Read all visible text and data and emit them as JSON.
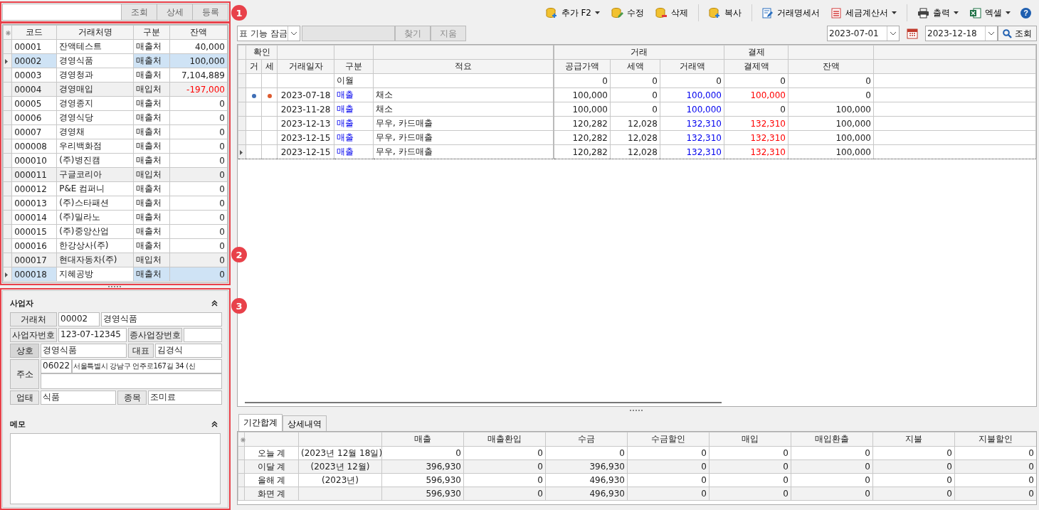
{
  "left_panel": {
    "search": {
      "buttons": [
        "조회",
        "상세",
        "등록"
      ]
    },
    "grid": {
      "columns": [
        "코드",
        "거래처명",
        "구분",
        "잔액"
      ],
      "rows": [
        {
          "code": "00001",
          "name": "잔액테스트",
          "type": "매출처",
          "balance": "40,000",
          "kind": "sale",
          "negative": false,
          "selected": false
        },
        {
          "code": "00002",
          "name": "경영식품",
          "type": "매출처",
          "balance": "100,000",
          "kind": "sale",
          "negative": false,
          "selected": true
        },
        {
          "code": "00003",
          "name": "경영청과",
          "type": "매출처",
          "balance": "7,104,889",
          "kind": "sale",
          "negative": false,
          "selected": false
        },
        {
          "code": "00004",
          "name": "경영매입",
          "type": "매입처",
          "balance": "-197,000",
          "kind": "purchase",
          "negative": true,
          "selected": false
        },
        {
          "code": "00005",
          "name": "경영종지",
          "type": "매출처",
          "balance": "0",
          "kind": "sale",
          "negative": false,
          "selected": false
        },
        {
          "code": "00006",
          "name": "경영식당",
          "type": "매출처",
          "balance": "0",
          "kind": "sale",
          "negative": false,
          "selected": false
        },
        {
          "code": "00007",
          "name": "경영채",
          "type": "매출처",
          "balance": "0",
          "kind": "sale",
          "negative": false,
          "selected": false
        },
        {
          "code": "000008",
          "name": "우리백화점",
          "type": "매출처",
          "balance": "0",
          "kind": "sale",
          "negative": false,
          "selected": false
        },
        {
          "code": "000010",
          "name": "(주)병진캠",
          "type": "매출처",
          "balance": "0",
          "kind": "sale",
          "negative": false,
          "selected": false
        },
        {
          "code": "000011",
          "name": "구글코리아",
          "type": "매입처",
          "balance": "0",
          "kind": "purchase",
          "negative": false,
          "selected": false
        },
        {
          "code": "000012",
          "name": "P&E 컴퍼니",
          "type": "매출처",
          "balance": "0",
          "kind": "sale",
          "negative": false,
          "selected": false
        },
        {
          "code": "000013",
          "name": "(주)스타패션",
          "type": "매출처",
          "balance": "0",
          "kind": "sale",
          "negative": false,
          "selected": false
        },
        {
          "code": "000014",
          "name": "(주)밀라노",
          "type": "매출처",
          "balance": "0",
          "kind": "sale",
          "negative": false,
          "selected": false
        },
        {
          "code": "000015",
          "name": "(주)중앙산업",
          "type": "매출처",
          "balance": "0",
          "kind": "sale",
          "negative": false,
          "selected": false
        },
        {
          "code": "000016",
          "name": "한강상사(주)",
          "type": "매출처",
          "balance": "0",
          "kind": "sale",
          "negative": false,
          "selected": false
        },
        {
          "code": "000017",
          "name": "현대자동차(주)",
          "type": "매입처",
          "balance": "0",
          "kind": "purchase",
          "negative": false,
          "selected": false
        },
        {
          "code": "000018",
          "name": "지혜공방",
          "type": "매출처",
          "balance": "0",
          "kind": "sale",
          "negative": false,
          "selected": true
        }
      ]
    }
  },
  "detail": {
    "title": "사업자",
    "client_label": "거래처",
    "client_code": "00002",
    "client_name": "경영식품",
    "bizno_label": "사업자번호",
    "bizno": "123-07-12345",
    "subbiz_label": "종사업장번호",
    "company_label": "상호",
    "company": "경영식품",
    "ceo_label": "대표",
    "ceo": "김경식",
    "address_label": "주소",
    "zip": "06022",
    "address": "서울특별시 강남구 언주로167길 34 (신",
    "biztype_label": "업태",
    "biztype": "식품",
    "item_label": "종목",
    "item": "조미료",
    "memo_title": "메모"
  },
  "toolbar": [
    {
      "label": "추가 F2",
      "kind": "db-plus",
      "dropdown": true
    },
    {
      "label": "수정",
      "kind": "db-edit",
      "dropdown": false
    },
    {
      "label": "삭제",
      "kind": "db-minus",
      "dropdown": false
    },
    {
      "label": "복사",
      "kind": "db-copy",
      "dropdown": false
    },
    {
      "label": "거래명세서",
      "kind": "doc-edit",
      "dropdown": false
    },
    {
      "label": "세금계산서",
      "kind": "doc-table",
      "dropdown": true
    },
    {
      "label": "출력",
      "kind": "printer",
      "dropdown": true
    },
    {
      "label": "엑셀",
      "kind": "excel",
      "dropdown": true
    }
  ],
  "help": "?",
  "filter": {
    "lock_option": "표 기능 잠금",
    "find": "찾기",
    "clear": "지움",
    "date_from": "2023-07-01",
    "date_to": "2023-12-18",
    "search": "조회"
  },
  "ledger": {
    "groups": {
      "confirm": "확인",
      "trade": "거래",
      "payment": "결제"
    },
    "columns": [
      "거",
      "세",
      "거래일자",
      "구분",
      "적요",
      "공급가액",
      "세액",
      "거래액",
      "결제액",
      "잔액"
    ],
    "rows": [
      {
        "kind": "carryover",
        "date": "",
        "type": "이월",
        "memo": "",
        "supply": "0",
        "tax": "0",
        "amount": "0",
        "payment": "0",
        "balance": "0",
        "confirm_trade": false,
        "confirm_tax": false,
        "paid": false,
        "selected": false
      },
      {
        "kind": "entry",
        "date": "2023-07-18",
        "type": "매출",
        "memo": "채소",
        "supply": "100,000",
        "tax": "0",
        "amount": "100,000",
        "payment": "100,000",
        "balance": "0",
        "confirm_trade": true,
        "confirm_tax": true,
        "paid": true,
        "selected": false
      },
      {
        "kind": "entry",
        "date": "2023-11-28",
        "type": "매출",
        "memo": "채소",
        "supply": "100,000",
        "tax": "0",
        "amount": "100,000",
        "payment": "0",
        "balance": "100,000",
        "confirm_trade": false,
        "confirm_tax": false,
        "paid": false,
        "selected": false
      },
      {
        "kind": "entry",
        "date": "2023-12-13",
        "type": "매출",
        "memo": "무우, 카드매출",
        "supply": "120,282",
        "tax": "12,028",
        "amount": "132,310",
        "payment": "132,310",
        "balance": "100,000",
        "confirm_trade": false,
        "confirm_tax": false,
        "paid": true,
        "selected": false
      },
      {
        "kind": "entry",
        "date": "2023-12-15",
        "type": "매출",
        "memo": "무우, 카드매출",
        "supply": "120,282",
        "tax": "12,028",
        "amount": "132,310",
        "payment": "132,310",
        "balance": "100,000",
        "confirm_trade": false,
        "confirm_tax": false,
        "paid": true,
        "selected": false
      },
      {
        "kind": "entry",
        "date": "2023-12-15",
        "type": "매출",
        "memo": "무우, 카드매출",
        "supply": "120,282",
        "tax": "12,028",
        "amount": "132,310",
        "payment": "132,310",
        "balance": "100,000",
        "confirm_trade": false,
        "confirm_tax": false,
        "paid": true,
        "selected": true
      }
    ]
  },
  "summary": {
    "tabs": [
      {
        "label": "기간합계",
        "selected": true
      },
      {
        "label": "상세내역",
        "selected": false
      }
    ],
    "columns": [
      "매출",
      "매출환입",
      "수금",
      "수금할인",
      "매입",
      "매입환출",
      "지불",
      "지불할인"
    ],
    "rows": [
      {
        "label": "오늘 계",
        "period": "(2023년 12월 18일)",
        "values": [
          "0",
          "0",
          "0",
          "0",
          "0",
          "0",
          "0",
          "0"
        ]
      },
      {
        "label": "이달 계",
        "period": "(2023년 12월)",
        "values": [
          "396,930",
          "0",
          "396,930",
          "0",
          "0",
          "0",
          "0",
          "0"
        ]
      },
      {
        "label": "올해 계",
        "period": "(2023년)",
        "values": [
          "596,930",
          "0",
          "496,930",
          "0",
          "0",
          "0",
          "0",
          "0"
        ]
      },
      {
        "label": "화면 계",
        "values": [
          "596,930",
          "0",
          "496,930",
          "0",
          "0",
          "0",
          "0",
          "0"
        ]
      }
    ]
  },
  "callouts": [
    "1",
    "2",
    "3"
  ]
}
